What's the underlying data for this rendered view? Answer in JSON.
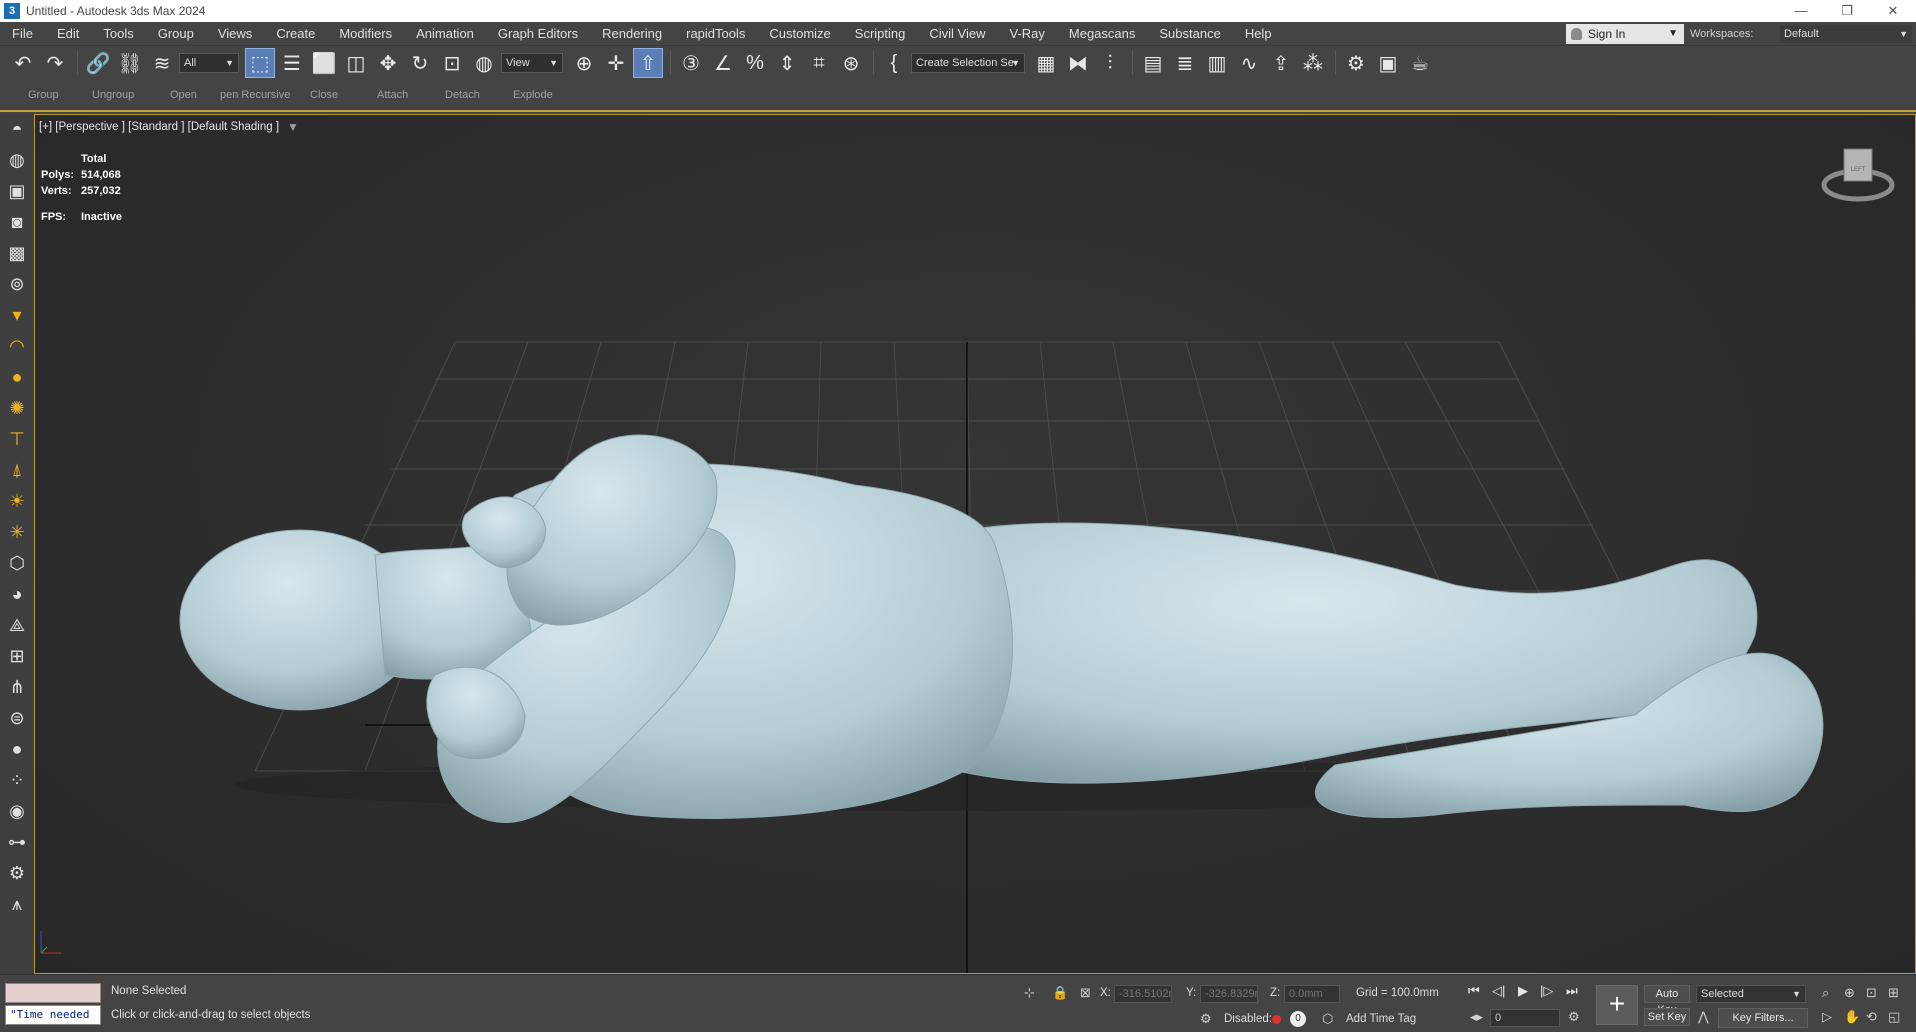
{
  "window": {
    "title": "Untitled - Autodesk 3ds Max 2024",
    "app_icon_glyph": "3",
    "controls": [
      "—",
      "❐",
      "✕"
    ]
  },
  "menu": [
    "File",
    "Edit",
    "Tools",
    "Group",
    "Views",
    "Create",
    "Modifiers",
    "Animation",
    "Graph Editors",
    "Rendering",
    "rapidTools",
    "Customize",
    "Scripting",
    "Civil View",
    "V-Ray",
    "Megascans",
    "Substance",
    "Help"
  ],
  "account": {
    "sign_in": "Sign In",
    "workspaces_label": "Workspaces:",
    "workspace": "Default"
  },
  "toolbar": {
    "selection_filter": "All",
    "ref_coord": "View",
    "named_selection": "Create Selection Se"
  },
  "ribbon": [
    "Group",
    "Ungroup",
    "Open",
    "pen Recursive",
    "Close",
    "Attach",
    "Detach",
    "Explode"
  ],
  "viewport": {
    "label": "[+] [Perspective ] [Standard ] [Default Shading ]",
    "stats": {
      "header": "Total",
      "polys_label": "Polys:",
      "polys": "514,068",
      "verts_label": "Verts:",
      "verts": "257,032",
      "fps_label": "FPS:",
      "fps": "Inactive"
    },
    "viewcube_face": "LEFT"
  },
  "status": {
    "maxscript_text": "\"Time needed",
    "selection": "None Selected",
    "prompt": "Click or click-and-drag to select objects",
    "x_label": "X:",
    "x_value": "-316.5102r",
    "y_label": "Y:",
    "y_value": "-326.8329r",
    "z_label": "Z:",
    "z_value": "0.0mm",
    "grid": "Grid = 100.0mm",
    "disabled": "Disabled:",
    "disabled_count": "0",
    "add_time_tag": "Add Time Tag",
    "frame": "0",
    "auto_key": "Auto Key",
    "set_key": "Set Key",
    "key_mode": "Selected",
    "key_filters": "Key Filters..."
  },
  "colors": {
    "viewport_border": "#b89a2f",
    "mesh": "#b8d0d8",
    "accent": "#5a7fb6",
    "record_dot": "#e03030"
  }
}
